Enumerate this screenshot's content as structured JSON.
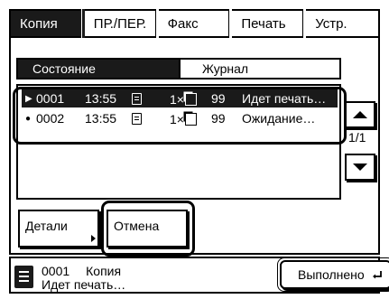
{
  "tabs": [
    {
      "label": "Копия",
      "active": true
    },
    {
      "label": "ПР./ПЕР.",
      "active": false
    },
    {
      "label": "Факс",
      "active": false
    },
    {
      "label": "Печать",
      "active": false
    },
    {
      "label": "Устр.",
      "active": false
    }
  ],
  "subtabs": {
    "status": "Состояние",
    "journal": "Журнал"
  },
  "jobs": [
    {
      "marker": "▶",
      "number": "0001",
      "time": "13:55",
      "doc_icon": "document-icon",
      "copies": "1×",
      "stack_icon": "pages-icon",
      "pages": "99",
      "status": "Идет печать…",
      "selected": true
    },
    {
      "marker": "●",
      "number": "0002",
      "time": "13:55",
      "doc_icon": "document-icon",
      "copies": "1×",
      "stack_icon": "pages-icon",
      "pages": "99",
      "status": "Ожидание…",
      "selected": false
    }
  ],
  "pagination": {
    "indicator": "1/1"
  },
  "actions": {
    "details": "Детали",
    "cancel": "Отмена"
  },
  "status_bar": {
    "job_number": "0001",
    "job_type": "Копия",
    "job_status": "Идет печать…",
    "done_label": "Выполнено"
  }
}
